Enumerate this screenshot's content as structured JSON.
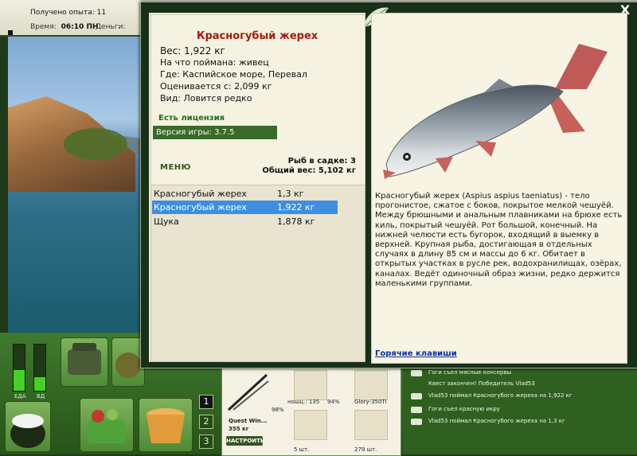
{
  "status_bar": {
    "experience": "Получено опыта: 11",
    "time_label": "Время:",
    "time_value": "06:10 ПН",
    "money_label": "Деньги:"
  },
  "dialog": {
    "fish_name": "Красногубый жерех",
    "weight": "Вес: 1,922 кг",
    "caught_with": "На что поймана: живец",
    "location": "Где: Каспийское море, Перевал",
    "valued_from": "Оценивается с: 2,099 кг",
    "rarity": "Вид: Ловится редко",
    "license": "Есть лицензия",
    "version": "Версия игры: 3.7.5",
    "menu_label": "МЕНЮ",
    "fish_in_keepnet": "Рыб в садке: 3",
    "total_weight": "Общий вес: 5,102 кг",
    "catch_list": [
      {
        "name": "Красногубый жерех",
        "weight": "1,3 кг",
        "selected": false
      },
      {
        "name": "Красногубый жерех",
        "weight": "1,922 кг",
        "selected": true
      },
      {
        "name": "Щука",
        "weight": "1,878 кг",
        "selected": false
      }
    ],
    "description": "Красногубый жерех (Aspius aspius taeniatus) - тело прогонистое, сжатое с боков, покрытое мелкой чешуёй. Между брюшными и анальным плавниками на брюхе есть киль, покрытый чешуёй. Рот большой, конечный. На нижней челюсти есть бугорок, входящий в выемку в верхней. Крупная рыба, достигающая в отдельных случаях в длину 85 см и массы до 6 кг. Обитает в открытых участках в русле рек, водохранилищах, озёрах, каналах. Ведёт одиночный образ жизни, редко держится маленькими группами.",
    "hotkeys_link": "Горячие клавиши",
    "close_glyph": "X"
  },
  "bottom_panel": {
    "meter_labels": [
      "ЕДА",
      "ВД"
    ],
    "meter_levels": [
      0.45,
      0.3
    ],
    "slot_numbers": [
      "1",
      "2",
      "3"
    ],
    "active_slot": "1",
    "rod_name": "Quest Win...",
    "rod_count": "355 кг",
    "rod_percent": "98%",
    "reel_label": "ношц.: 135",
    "reel_percent": "94%",
    "lure_label": "Glory-350Ti",
    "hook_count": "5 шт.",
    "bait_count": "279 шт.",
    "setup_button": "НАСТРОИТЬ",
    "log": [
      "Гоги съел мясные консервы",
      "Квест закончен! Победитель Vlad53",
      "Vlad53 поймал Красногубого жереха на 1,922 кг",
      "Гоги съел красную икру",
      "Vlad53 поймал Красногубого жереха на 1,3 кг"
    ]
  },
  "colors": {
    "accent_green": "#3a6a2a",
    "title_red": "#a31b0f",
    "selection_blue": "#3d8ee0",
    "link_blue": "#0a2fa8"
  }
}
